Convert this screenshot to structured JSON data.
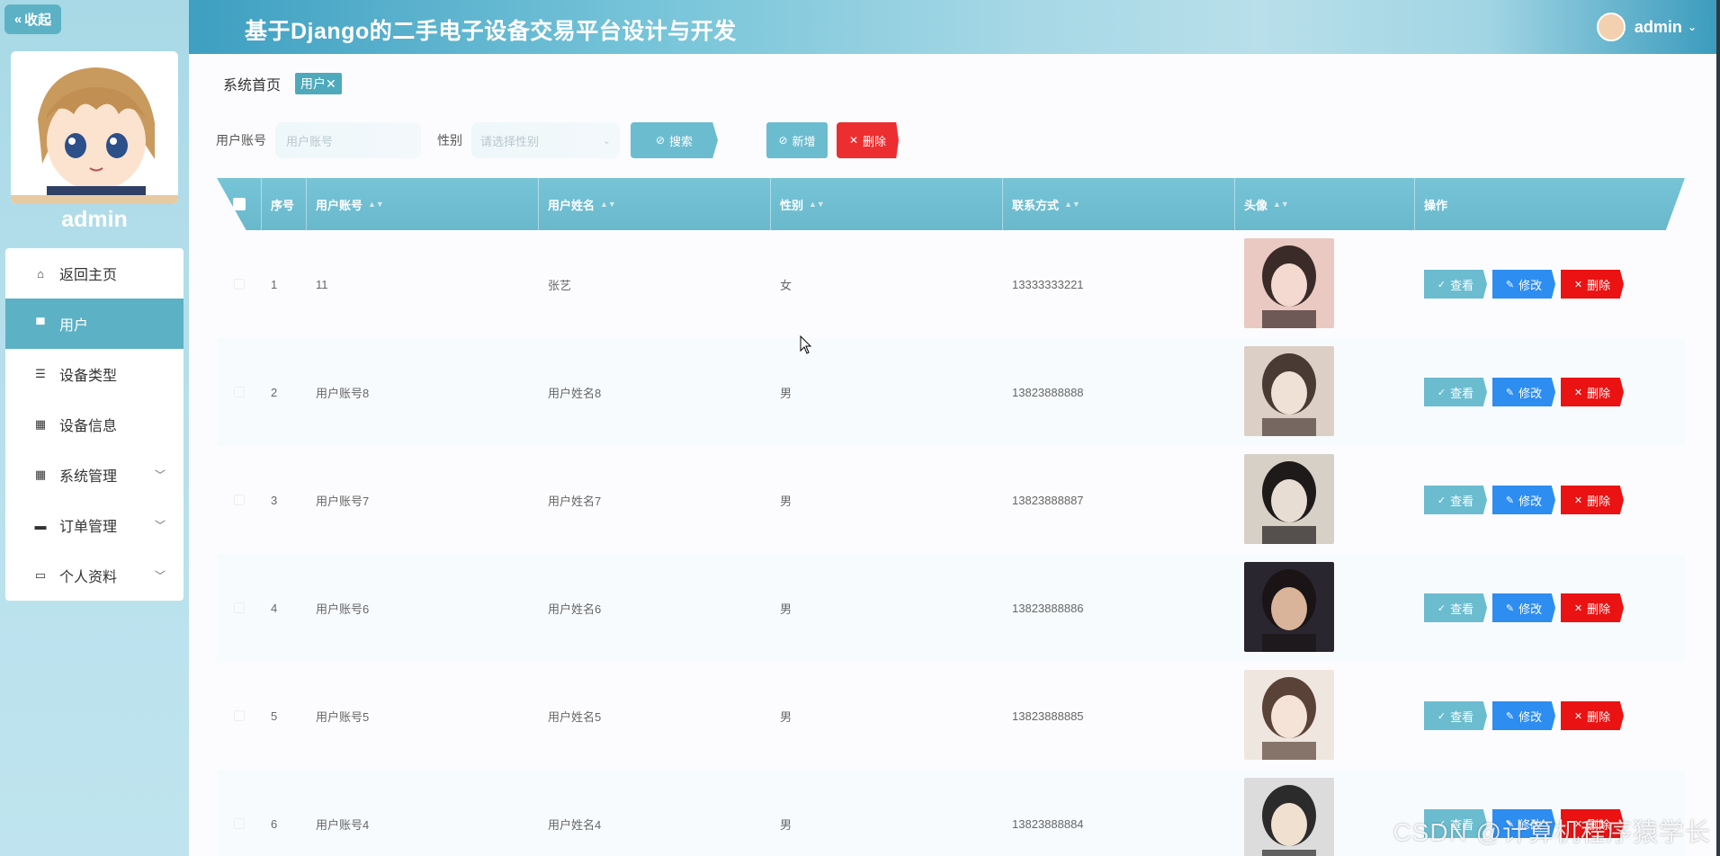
{
  "app": {
    "title": "基于Django的二手电子设备交易平台设计与开发",
    "username": "admin"
  },
  "sidebar": {
    "collapse_label": "收起",
    "user_name": "admin",
    "items": [
      {
        "label": "返回主页",
        "icon": "home-icon"
      },
      {
        "label": "用户",
        "icon": "user-icon",
        "active": true
      },
      {
        "label": "设备类型",
        "icon": "list-icon"
      },
      {
        "label": "设备信息",
        "icon": "grid-icon"
      },
      {
        "label": "系统管理",
        "icon": "grid-icon",
        "expandable": true
      },
      {
        "label": "订单管理",
        "icon": "monitor-icon",
        "expandable": true
      },
      {
        "label": "个人资料",
        "icon": "card-icon",
        "expandable": true
      }
    ]
  },
  "breadcrumb": {
    "home": "系统首页",
    "tag": "用户",
    "tag_close": "✕"
  },
  "search": {
    "account_label": "用户账号",
    "account_placeholder": "用户账号",
    "gender_label": "性别",
    "gender_placeholder": "请选择性别",
    "search_btn": "搜索",
    "add_btn": "新增",
    "delete_btn": "删除"
  },
  "table": {
    "headers": [
      "序号",
      "用户账号",
      "用户姓名",
      "性别",
      "联系方式",
      "头像",
      "操作"
    ],
    "rows": [
      {
        "idx": "1",
        "account": "11",
        "name": "张艺",
        "gender": "女",
        "phone": "13333333221"
      },
      {
        "idx": "2",
        "account": "用户账号8",
        "name": "用户姓名8",
        "gender": "男",
        "phone": "13823888888"
      },
      {
        "idx": "3",
        "account": "用户账号7",
        "name": "用户姓名7",
        "gender": "男",
        "phone": "13823888887"
      },
      {
        "idx": "4",
        "account": "用户账号6",
        "name": "用户姓名6",
        "gender": "男",
        "phone": "13823888886"
      },
      {
        "idx": "5",
        "account": "用户账号5",
        "name": "用户姓名5",
        "gender": "男",
        "phone": "13823888885"
      },
      {
        "idx": "6",
        "account": "用户账号4",
        "name": "用户姓名4",
        "gender": "男",
        "phone": "13823888884"
      }
    ],
    "actions": {
      "view": "查看",
      "edit": "修改",
      "delete": "删除"
    }
  },
  "watermark": "CSDN @计算机程序猿学长",
  "colors": {
    "accent": "#5cb1c5",
    "edit": "#2e8df0",
    "danger": "#ea1212"
  }
}
